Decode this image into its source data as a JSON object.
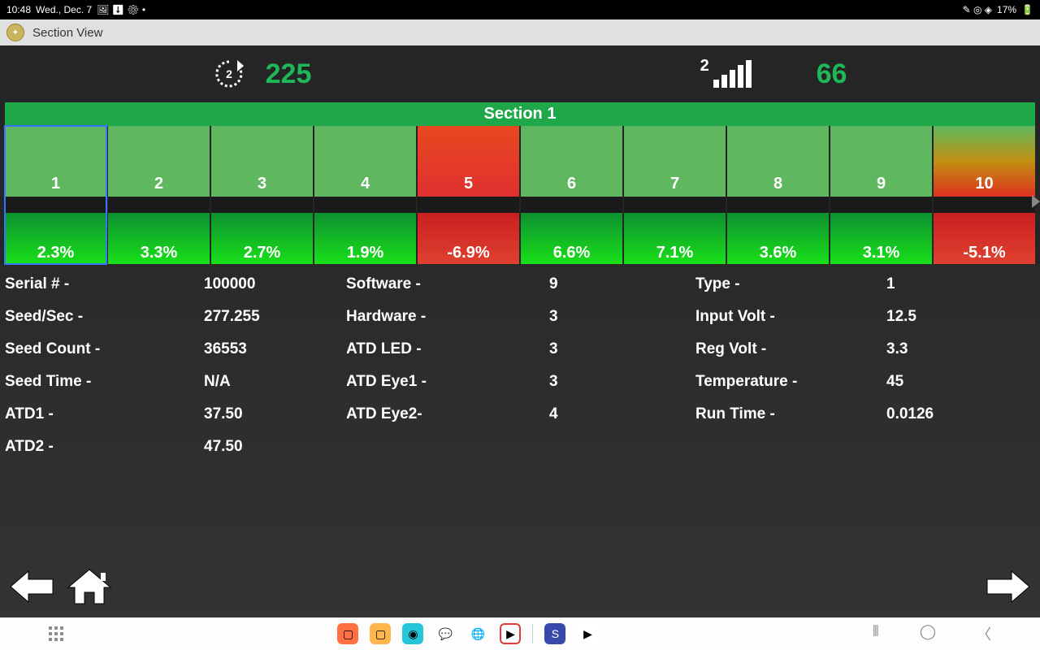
{
  "status_bar": {
    "time": "10:48",
    "date": "Wed., Dec. 7",
    "battery": "17%"
  },
  "app": {
    "title": "Section View"
  },
  "top": {
    "refresh_count": "2",
    "left_value": "225",
    "signal_num": "2",
    "right_value": "66"
  },
  "section": {
    "title": "Section 1",
    "cells": [
      {
        "n": "1",
        "pct": "2.3%",
        "status": "green",
        "selected": true
      },
      {
        "n": "2",
        "pct": "3.3%",
        "status": "green"
      },
      {
        "n": "3",
        "pct": "2.7%",
        "status": "green"
      },
      {
        "n": "4",
        "pct": "1.9%",
        "status": "green"
      },
      {
        "n": "5",
        "pct": "-6.9%",
        "status": "red"
      },
      {
        "n": "6",
        "pct": "6.6%",
        "status": "green"
      },
      {
        "n": "7",
        "pct": "7.1%",
        "status": "green"
      },
      {
        "n": "8",
        "pct": "3.6%",
        "status": "green"
      },
      {
        "n": "9",
        "pct": "3.1%",
        "status": "green"
      },
      {
        "n": "10",
        "pct": "-5.1%",
        "status": "redgrad"
      }
    ]
  },
  "details": {
    "col1": [
      {
        "label": "Serial # -",
        "value": "100000"
      },
      {
        "label": "Seed/Sec -",
        "value": "277.255"
      },
      {
        "label": "Seed Count -",
        "value": "36553"
      },
      {
        "label": "Seed Time -",
        "value": "N/A"
      },
      {
        "label": "ATD1 -",
        "value": "37.50"
      },
      {
        "label": "ATD2 -",
        "value": "47.50"
      }
    ],
    "col2": [
      {
        "label": "Software -",
        "value": "9"
      },
      {
        "label": "Hardware -",
        "value": "3"
      },
      {
        "label": "ATD LED -",
        "value": "3"
      },
      {
        "label": "ATD Eye1 -",
        "value": "3"
      },
      {
        "label": "ATD Eye2-",
        "value": "4"
      }
    ],
    "col3": [
      {
        "label": "Type -",
        "value": "1"
      },
      {
        "label": "Input Volt -",
        "value": "12.5"
      },
      {
        "label": "Reg Volt -",
        "value": "3.3"
      },
      {
        "label": "Temperature -",
        "value": "45"
      },
      {
        "label": "Run Time -",
        "value": "0.0126"
      }
    ]
  }
}
